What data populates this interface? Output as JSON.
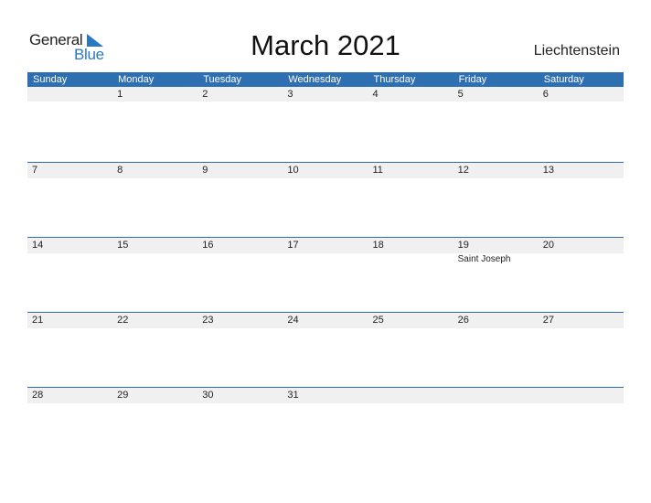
{
  "logo": {
    "general": "General",
    "blue": "Blue",
    "accent_color": "#2a78c2"
  },
  "title": "March 2021",
  "country": "Liechtenstein",
  "header_color": "#2e6fb1",
  "weekdays": [
    "Sunday",
    "Monday",
    "Tuesday",
    "Wednesday",
    "Thursday",
    "Friday",
    "Saturday"
  ],
  "weeks": [
    {
      "days": [
        "",
        "1",
        "2",
        "3",
        "4",
        "5",
        "6"
      ],
      "events": [
        "",
        "",
        "",
        "",
        "",
        "",
        ""
      ]
    },
    {
      "days": [
        "7",
        "8",
        "9",
        "10",
        "11",
        "12",
        "13"
      ],
      "events": [
        "",
        "",
        "",
        "",
        "",
        "",
        ""
      ]
    },
    {
      "days": [
        "14",
        "15",
        "16",
        "17",
        "18",
        "19",
        "20"
      ],
      "events": [
        "",
        "",
        "",
        "",
        "",
        "Saint Joseph",
        ""
      ]
    },
    {
      "days": [
        "21",
        "22",
        "23",
        "24",
        "25",
        "26",
        "27"
      ],
      "events": [
        "",
        "",
        "",
        "",
        "",
        "",
        ""
      ]
    },
    {
      "days": [
        "28",
        "29",
        "30",
        "31",
        "",
        "",
        ""
      ],
      "events": [
        "",
        "",
        "",
        "",
        "",
        "",
        ""
      ]
    }
  ]
}
